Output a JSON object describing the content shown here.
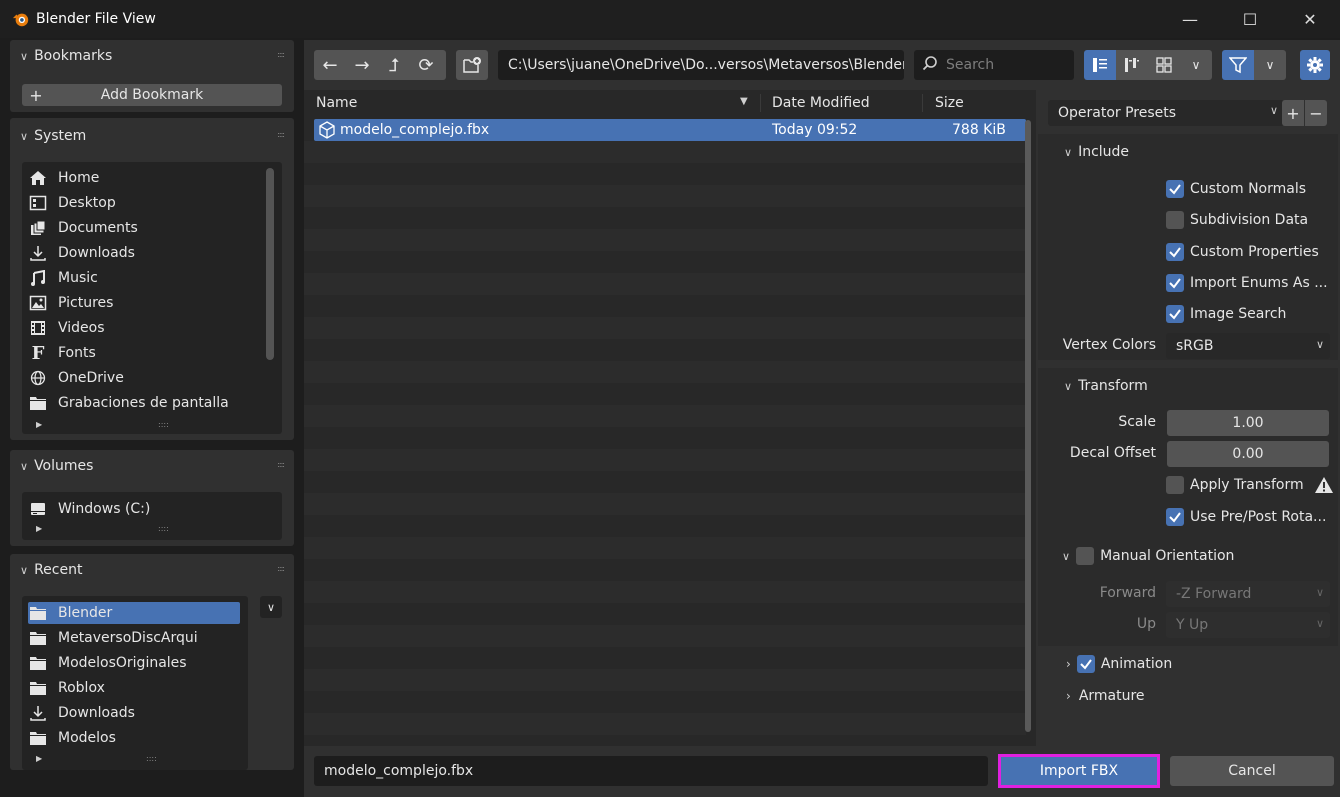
{
  "window": {
    "title": "Blender File View",
    "minimize": "—",
    "maximize": "☐",
    "close": "✕"
  },
  "sidebar": {
    "bookmarks": {
      "title": "Bookmarks",
      "add_label": "Add Bookmark"
    },
    "system": {
      "title": "System",
      "items": [
        {
          "label": "Home",
          "icon": "home-icon"
        },
        {
          "label": "Desktop",
          "icon": "desktop-icon"
        },
        {
          "label": "Documents",
          "icon": "documents-icon"
        },
        {
          "label": "Downloads",
          "icon": "downloads-icon"
        },
        {
          "label": "Music",
          "icon": "music-icon"
        },
        {
          "label": "Pictures",
          "icon": "pictures-icon"
        },
        {
          "label": "Videos",
          "icon": "videos-icon"
        },
        {
          "label": "Fonts",
          "icon": "fonts-icon"
        },
        {
          "label": "OneDrive",
          "icon": "globe-icon"
        },
        {
          "label": "Grabaciones de pantalla",
          "icon": "folder-icon"
        }
      ]
    },
    "volumes": {
      "title": "Volumes",
      "items": [
        {
          "label": "Windows (C:)",
          "icon": "disk-icon"
        }
      ]
    },
    "recent": {
      "title": "Recent",
      "items": [
        {
          "label": "Blender",
          "icon": "folder-icon",
          "selected": true
        },
        {
          "label": "MetaversoDiscArqui",
          "icon": "folder-icon"
        },
        {
          "label": "ModelosOriginales",
          "icon": "folder-icon"
        },
        {
          "label": "Roblox",
          "icon": "folder-icon"
        },
        {
          "label": "Downloads",
          "icon": "downloads-icon"
        },
        {
          "label": "Modelos",
          "icon": "folder-icon"
        }
      ]
    }
  },
  "toolbar": {
    "path": "C:\\Users\\juane\\OneDrive\\Do...versos\\Metaversos\\Blender\\",
    "search_placeholder": "Search"
  },
  "filelist": {
    "columns": {
      "name": "Name",
      "date": "Date Modified",
      "size": "Size"
    },
    "files": [
      {
        "name": "modelo_complejo.fbx",
        "date": "Today 09:52",
        "size": "788 KiB",
        "selected": true
      }
    ]
  },
  "bottom": {
    "filename": "modelo_complejo.fbx",
    "import_label": "Import FBX",
    "cancel_label": "Cancel"
  },
  "options": {
    "presets_label": "Operator Presets",
    "include": {
      "title": "Include",
      "checks": [
        {
          "label": "Custom Normals",
          "checked": true
        },
        {
          "label": "Subdivision Data",
          "checked": false
        },
        {
          "label": "Custom Properties",
          "checked": true
        },
        {
          "label": "Import Enums As ...",
          "checked": true
        },
        {
          "label": "Image Search",
          "checked": true
        }
      ],
      "vertex_colors_label": "Vertex Colors",
      "vertex_colors_value": "sRGB"
    },
    "transform": {
      "title": "Transform",
      "scale_label": "Scale",
      "scale_value": "1.00",
      "decal_label": "Decal Offset",
      "decal_value": "0.00",
      "apply_transform": {
        "label": "Apply Transform",
        "checked": false
      },
      "use_prepost": {
        "label": "Use Pre/Post Rota...",
        "checked": true
      }
    },
    "manual_orientation": {
      "title": "Manual Orientation",
      "checked": false,
      "forward_label": "Forward",
      "forward_value": "-Z Forward",
      "up_label": "Up",
      "up_value": "Y Up"
    },
    "animation": {
      "title": "Animation",
      "checked": true
    },
    "armature": {
      "title": "Armature"
    }
  },
  "colors": {
    "accent": "#4772b3",
    "highlight_border": "#e020e0",
    "panel": "#303030",
    "background": "#1d1d1d"
  }
}
